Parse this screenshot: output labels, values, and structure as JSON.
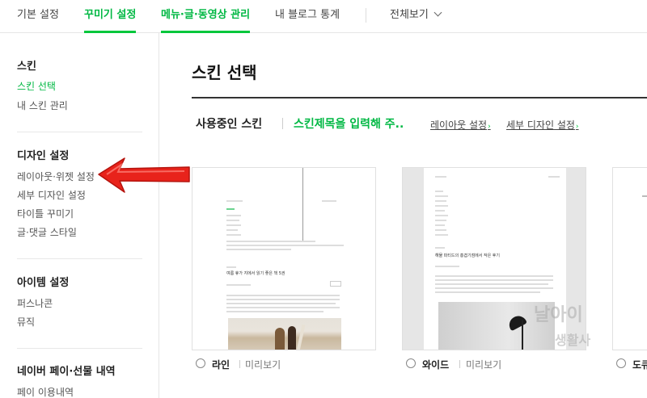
{
  "topnav": {
    "tabs": [
      "기본 설정",
      "꾸미기 설정",
      "메뉴·글·동영상 관리",
      "내 블로그 통계"
    ],
    "view_all": "전체보기"
  },
  "sidebar": {
    "skin": {
      "title": "스킨",
      "items": [
        "스킨 선택",
        "내 스킨 관리"
      ]
    },
    "design": {
      "title": "디자인 설정",
      "items": [
        "레이아웃·위젯 설정",
        "세부 디자인 설정",
        "타이틀 꾸미기",
        "글·댓글 스타일"
      ]
    },
    "item": {
      "title": "아이템 설정",
      "items": [
        "퍼스나콘",
        "뮤직"
      ]
    },
    "pay": {
      "title": "네이버 페이·선물 내역",
      "items": [
        "페이 이용내역"
      ]
    }
  },
  "main": {
    "title": "스킨 선택",
    "current_label": "사용중인 스킨",
    "current_skin": "스킨제목을 입력해 주..",
    "layout_link": "레이아웃 설정",
    "detail_link": "세부 디자인 설정"
  },
  "cards": [
    {
      "name": "라인",
      "preview": "미리보기",
      "post_title": "여름 휴가 지에서 읽기 좋은 책 5권"
    },
    {
      "name": "와이드",
      "preview": "미리보기",
      "post_title": "해물 파티드의 흥겹기점에서 작은 후기"
    },
    {
      "name": "도큐",
      "preview": ""
    }
  ],
  "colors": {
    "accent": "#00c73c",
    "arrow": "#e8231b"
  }
}
